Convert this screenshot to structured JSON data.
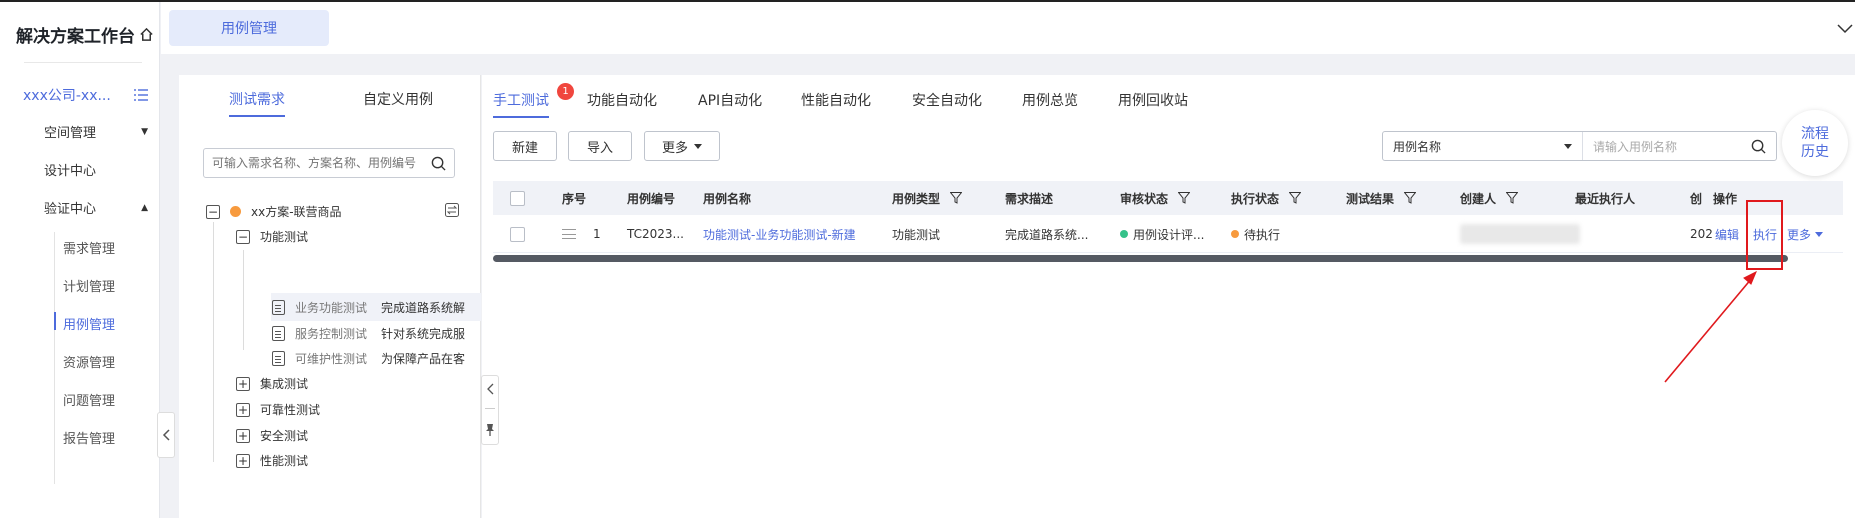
{
  "sidebar": {
    "brand": "解决方案工作台",
    "org": "xxx公司-xx...",
    "nav": [
      {
        "label": "空间管理",
        "arrow": "▼"
      },
      {
        "label": "设计中心",
        "arrow": ""
      },
      {
        "label": "验证中心",
        "arrow": "▲"
      }
    ],
    "sub_items": [
      "需求管理",
      "计划管理",
      "用例管理",
      "资源管理",
      "问题管理",
      "报告管理"
    ]
  },
  "header": {
    "tab_label": "用例管理"
  },
  "left_panel": {
    "tabs": [
      "测试需求",
      "自定义用例"
    ],
    "search_placeholder": "可输入需求名称、方案名称、用例编号",
    "tree": {
      "root": "xx方案-联营商品",
      "func": "功能测试",
      "leaves": [
        {
          "name": "业务功能测试",
          "desc": "完成道路系统解"
        },
        {
          "name": "服务控制测试",
          "desc": "针对系统完成服"
        },
        {
          "name": "可维护性测试",
          "desc": "为保障产品在客"
        }
      ],
      "others": [
        "集成测试",
        "可靠性测试",
        "安全测试",
        "性能测试"
      ]
    }
  },
  "main": {
    "tabs": [
      "手工测试",
      "功能自动化",
      "API自动化",
      "性能自动化",
      "安全自动化",
      "用例总览",
      "用例回收站"
    ],
    "badge": "1",
    "buttons": {
      "new": "新建",
      "import": "导入",
      "more": "更多"
    },
    "filter": {
      "field": "用例名称",
      "placeholder": "请输入用例名称"
    },
    "float_btn": [
      "流程",
      "历史"
    ],
    "columns": [
      "序号",
      "用例编号",
      "用例名称",
      "用例类型",
      "需求描述",
      "审核状态",
      "执行状态",
      "测试结果",
      "创建人",
      "最近执行人",
      "创",
      "操作"
    ],
    "row": {
      "index": "1",
      "id": "TC2023...",
      "name": "功能测试-业务功能测试-新建",
      "type": "功能测试",
      "desc": "完成道路系统...",
      "review": "用例设计评...",
      "exec": "待执行",
      "created": "202",
      "actions": {
        "edit": "编辑",
        "execute": "执行",
        "more": "更多"
      }
    }
  },
  "colors": {
    "accent": "#4d6bdc",
    "review_dot": "#35c28a",
    "exec_dot": "#f79a3e",
    "badge": "#f0463e",
    "highlight": "#e0191d"
  }
}
